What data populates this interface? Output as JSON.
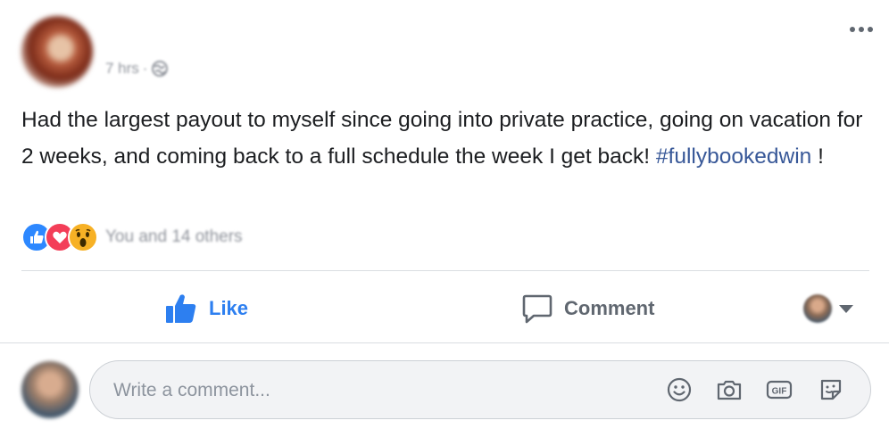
{
  "post": {
    "timestamp": "7 hrs",
    "separator": "·",
    "text_main": "Had the largest payout to myself since going into private practice, going on vacation for 2 weeks, and coming back to a full schedule the week I get back! ",
    "hashtag": "#fullybookedwin",
    "text_end": " !",
    "privacy_icon": "globe-icon",
    "menu_icon": "more-icon"
  },
  "reactions": {
    "icons": [
      "like-icon",
      "love-icon",
      "wow-icon"
    ],
    "summary": "You and 14 others"
  },
  "actions": {
    "like_label": "Like",
    "comment_label": "Comment"
  },
  "composer": {
    "placeholder": "Write a comment...",
    "icons": [
      "emoji-icon",
      "camera-icon",
      "gif-icon",
      "sticker-icon"
    ]
  },
  "colors": {
    "like_blue": "#2d7ff0",
    "hashtag": "#385898",
    "muted": "#606770",
    "love": "#f33e58",
    "wow": "#f7b125"
  }
}
